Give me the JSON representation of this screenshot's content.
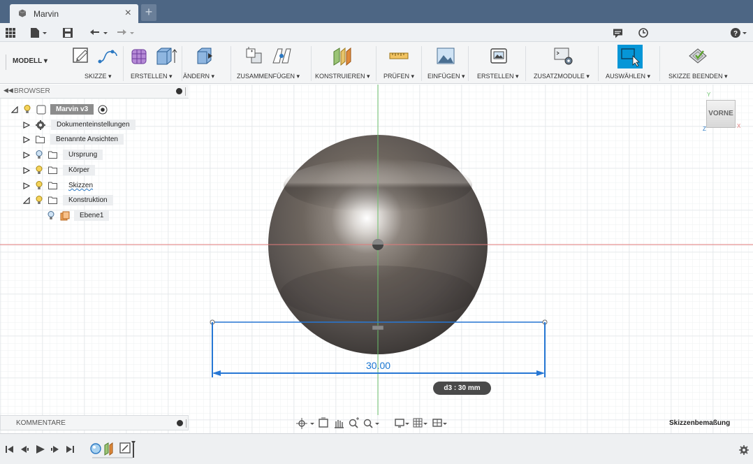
{
  "tab": {
    "title": "Marvin",
    "close": "×",
    "new": "+"
  },
  "ribbon": {
    "mode": "MODELL ▾",
    "groups": {
      "skizze": "SKIZZE ▾",
      "erstellen": "ERSTELLEN ▾",
      "aendern": "ÄNDERN ▾",
      "zusammenfuegen": "ZUSAMMENFÜGEN ▾",
      "konstruieren": "KONSTRUIEREN ▾",
      "pruefen": "PRÜFEN ▾",
      "einfuegen": "EINFÜGEN ▾",
      "erstellen2": "ERSTELLEN ▾",
      "zusatzmodule": "ZUSATZMODULE ▾",
      "auswaehlen": "AUSWÄHLEN ▾",
      "skizze_beenden": "SKIZZE BEENDEN ▾"
    }
  },
  "browser": {
    "title": "BROWSER",
    "root": "Marvin v3",
    "items": [
      {
        "label": "Dokumenteinstellungen"
      },
      {
        "label": "Benannte Ansichten"
      },
      {
        "label": "Ursprung"
      },
      {
        "label": "Körper"
      },
      {
        "label": "Skizzen"
      },
      {
        "label": "Konstruktion"
      },
      {
        "label": "Ebene1"
      }
    ]
  },
  "comments": {
    "title": "KOMMENTARE"
  },
  "viewport": {
    "dimension_value": "30.00",
    "dimension_tip": "d3 : 30 mm",
    "viewcube_face": "VORNE",
    "axis_labels": {
      "y": "Y",
      "x": "X",
      "z": "Z"
    }
  },
  "status": {
    "text": "Skizzenbemaßung"
  },
  "colors": {
    "titlebar": "#4d6684",
    "accent": "#0696d7",
    "dimension": "#1976d2",
    "x_axis": "#d9534f",
    "y_axis": "#4caf50"
  }
}
